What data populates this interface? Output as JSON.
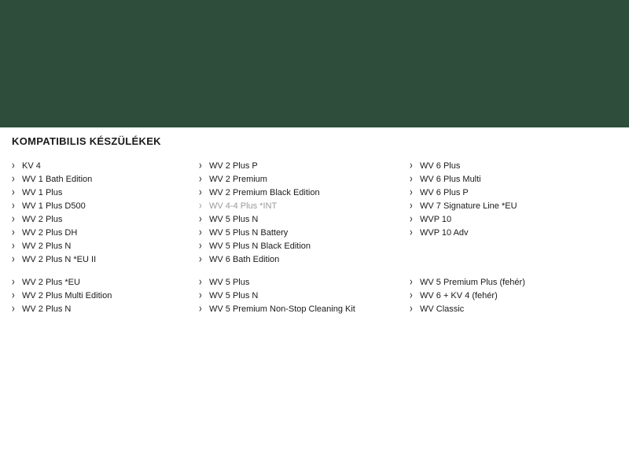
{
  "heading": "KOMPATIBILIS KÉSZÜLÉKEK",
  "columns": [
    {
      "groups": [
        {
          "items": [
            {
              "label": "KV 4"
            },
            {
              "label": "WV 1 Bath Edition"
            },
            {
              "label": "WV 1 Plus"
            },
            {
              "label": "WV 1 Plus D500"
            },
            {
              "label": "WV 2 Plus"
            },
            {
              "label": "WV 2 Plus DH"
            },
            {
              "label": "WV 2 Plus N"
            },
            {
              "label": "WV 2 Plus N *EU II"
            }
          ]
        },
        {
          "items": [
            {
              "label": "WV 2 Plus *EU"
            },
            {
              "label": "WV 2 Plus Multi Edition"
            },
            {
              "label": "WV 2 Plus N"
            }
          ]
        }
      ]
    },
    {
      "groups": [
        {
          "items": [
            {
              "label": "WV 2 Plus P"
            },
            {
              "label": "WV 2 Premium"
            },
            {
              "label": "WV 2 Premium Black Edition"
            },
            {
              "label": "WV 4-4 Plus *INT",
              "muted": true
            },
            {
              "label": "WV 5 Plus N"
            },
            {
              "label": "WV 5 Plus N Battery"
            },
            {
              "label": "WV 5 Plus N Black Edition"
            },
            {
              "label": "WV 6 Bath Edition"
            }
          ]
        },
        {
          "items": [
            {
              "label": "WV 5 Plus"
            },
            {
              "label": "WV 5 Plus N"
            },
            {
              "label": "WV 5 Premium Non-Stop Cleaning Kit"
            }
          ]
        }
      ]
    },
    {
      "groups": [
        {
          "items": [
            {
              "label": "WV 6 Plus"
            },
            {
              "label": "WV 6 Plus Multi"
            },
            {
              "label": "WV 6 Plus P"
            },
            {
              "label": "WV 7 Signature Line *EU"
            },
            {
              "label": "WVP 10"
            },
            {
              "label": "WVP 10 Adv"
            }
          ]
        },
        {
          "spacer": 2,
          "items": [
            {
              "label": "WV 5 Premium Plus (fehér)"
            },
            {
              "label": "WV 6 + KV 4 (fehér)"
            },
            {
              "label": "WV Classic"
            }
          ]
        }
      ]
    }
  ]
}
